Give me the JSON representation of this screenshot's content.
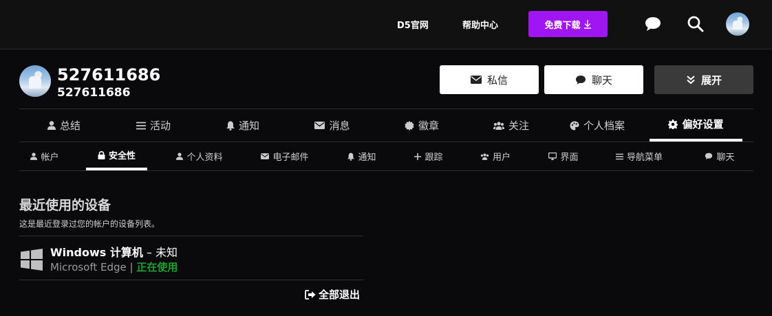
{
  "header": {
    "links": [
      "D5官网",
      "帮助中心"
    ],
    "download_label": "免费下载",
    "icons": [
      "chat-bubble-icon",
      "search-icon"
    ]
  },
  "profile": {
    "username": "527611686",
    "user_id": "527611686",
    "buttons": {
      "message": "私信",
      "chat": "聊天",
      "expand": "展开"
    }
  },
  "nav_primary": [
    {
      "label": "总结",
      "icon": "user-icon"
    },
    {
      "label": "活动",
      "icon": "list-icon"
    },
    {
      "label": "通知",
      "icon": "bell-icon"
    },
    {
      "label": "消息",
      "icon": "envelope-icon"
    },
    {
      "label": "徽章",
      "icon": "badge-icon"
    },
    {
      "label": "关注",
      "icon": "users-icon"
    },
    {
      "label": "个人档案",
      "icon": "palette-icon"
    },
    {
      "label": "偏好设置",
      "icon": "gear-icon",
      "active": true
    }
  ],
  "nav_secondary": [
    {
      "label": "帐户",
      "icon": "user-icon"
    },
    {
      "label": "安全性",
      "icon": "lock-icon",
      "active": true
    },
    {
      "label": "个人资料",
      "icon": "user-icon"
    },
    {
      "label": "电子邮件",
      "icon": "envelope-icon"
    },
    {
      "label": "通知",
      "icon": "bell-icon"
    },
    {
      "label": "跟踪",
      "icon": "plus-icon"
    },
    {
      "label": "用户",
      "icon": "users-icon"
    },
    {
      "label": "界面",
      "icon": "desktop-icon"
    },
    {
      "label": "导航菜单",
      "icon": "list-icon"
    },
    {
      "label": "聊天",
      "icon": "chat-bubble-icon"
    }
  ],
  "devices_section": {
    "title": "最近使用的设备",
    "description": "这是最近登录过您的帐户的设备列表。",
    "devices": [
      {
        "os": "Windows 计算机",
        "separator": " – ",
        "location": "未知",
        "browser": "Microsoft Edge",
        "divider": " | ",
        "status": "正在使用"
      }
    ],
    "logout_all_label": "全部退出"
  },
  "colors": {
    "accent": "#a016f3",
    "active_status": "#1fa12f",
    "background": "#0a0a0c",
    "header_bg": "#111111"
  }
}
